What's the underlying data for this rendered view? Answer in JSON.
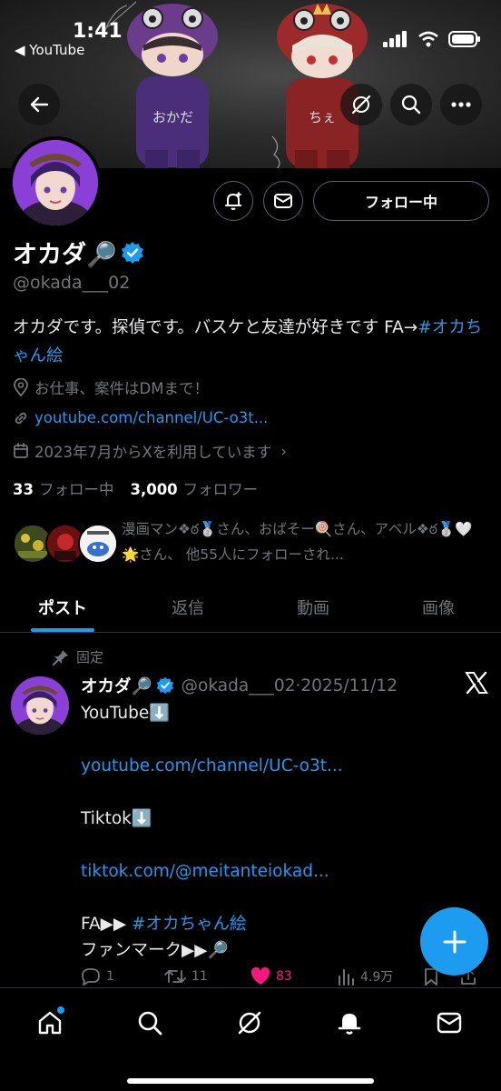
{
  "status_bar": {
    "time": "1:41",
    "back_app": "◀ YouTube"
  },
  "banner": {
    "left_char_text": "おかだ",
    "right_char_text": "ちぇ"
  },
  "profile": {
    "name": "オカダ🔎",
    "handle": "@okada___02",
    "follow_button": "フォロー中",
    "bio_text": "オカダです。探偵です。バスケと友達が好きです FA→",
    "bio_hashtag": "#オカちゃん絵",
    "job": "お仕事、案件はDMまで！",
    "website": "youtube.com/channel/UC-o3t...",
    "joined": "2023年7月からXを利用しています",
    "following_count": "33",
    "following_label": "フォロー中",
    "followers_count": "3,000",
    "followers_label": "フォロワー",
    "known_followers_text": "漫画マン❖ఠ🥈さん、おばそー🍭さん、アベル❖ఠ🥈🤍🌟さん、 他55人にフォローされ..."
  },
  "tabs": [
    {
      "label": "ポスト",
      "active": true
    },
    {
      "label": "返信",
      "active": false
    },
    {
      "label": "動画",
      "active": false
    },
    {
      "label": "画像",
      "active": false
    }
  ],
  "post": {
    "pinned_label": "固定",
    "author_name": "オカダ🔎",
    "author_meta": "@okada___02·2025/11/12",
    "lines": {
      "l1": "YouTube⬇️",
      "l2": "youtube.com/channel/UC-o3t...",
      "l3": "Tiktok⬇️",
      "l4": "tiktok.com/@meitanteiokad...",
      "l5_prefix": "FA▶▶ ",
      "l5_tag": "#オカちゃん絵",
      "l6": "ファンマーク▶▶🔎"
    },
    "replies": "1",
    "reposts": "11",
    "likes": "83",
    "views": "4.9万"
  },
  "colors": {
    "accent": "#1d9bf0",
    "like": "#f91880",
    "muted": "#71767b",
    "background": "#000000"
  }
}
